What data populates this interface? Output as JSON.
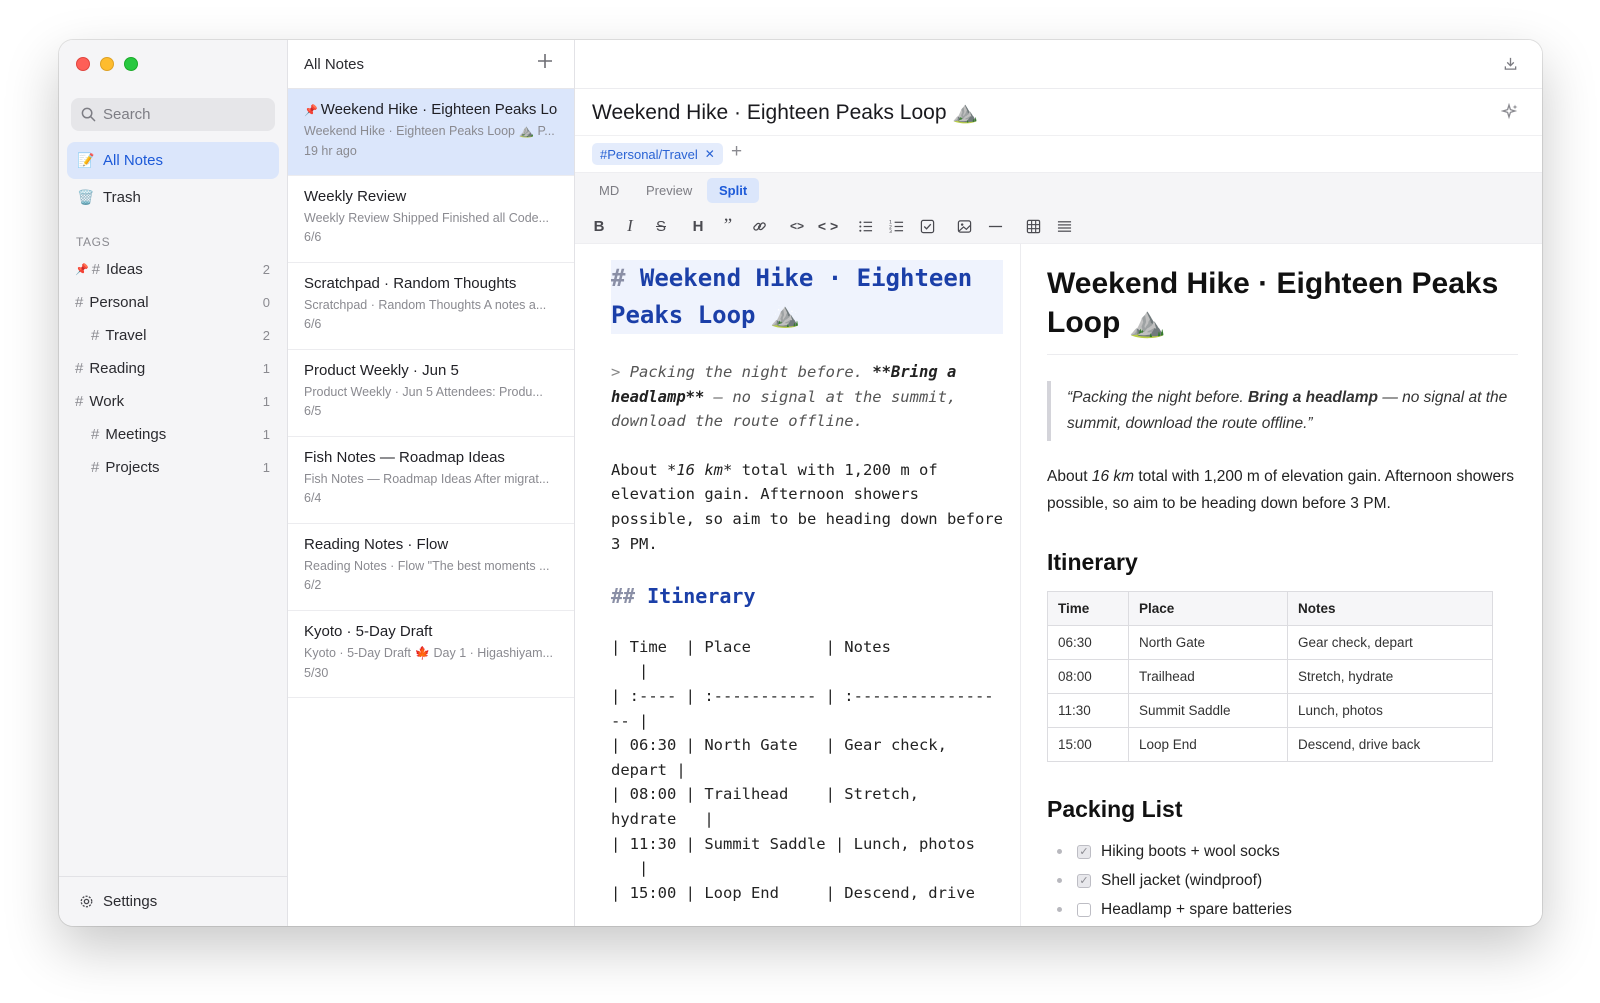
{
  "sidebar": {
    "search_placeholder": "Search",
    "nav": [
      {
        "label": "All Notes",
        "icon": "📝"
      },
      {
        "label": "Trash",
        "icon": "🗑️"
      }
    ],
    "tags_heading": "TAGS",
    "tags": [
      {
        "label": "Ideas",
        "count": "2",
        "pinned": true
      },
      {
        "label": "Personal",
        "count": "0"
      },
      {
        "label": "Travel",
        "count": "2"
      },
      {
        "label": "Reading",
        "count": "1"
      },
      {
        "label": "Work",
        "count": "1"
      },
      {
        "label": "Meetings",
        "count": "1"
      },
      {
        "label": "Projects",
        "count": "1"
      }
    ],
    "settings_label": "Settings"
  },
  "notes_list": {
    "title": "All Notes",
    "notes": [
      {
        "title": "Weekend Hike · Eighteen Peaks Loop",
        "snippet": "Weekend Hike · Eighteen Peaks Loop ⛰️ P...",
        "date": "19 hr ago"
      },
      {
        "title": "Weekly Review",
        "snippet": "Weekly Review Shipped Finished all Code...",
        "date": "6/6"
      },
      {
        "title": "Scratchpad · Random Thoughts",
        "snippet": "Scratchpad · Random Thoughts A notes a...",
        "date": "6/6"
      },
      {
        "title": "Product Weekly · Jun 5",
        "snippet": "Product Weekly · Jun 5 Attendees: Produ...",
        "date": "6/5"
      },
      {
        "title": "Fish Notes — Roadmap Ideas",
        "snippet": "Fish Notes — Roadmap Ideas After migrat...",
        "date": "6/4"
      },
      {
        "title": "Reading Notes · Flow",
        "snippet": "Reading Notes · Flow \"The best moments ...",
        "date": "6/2"
      },
      {
        "title": "Kyoto · 5-Day Draft",
        "snippet": "Kyoto · 5-Day Draft 🍁 Day 1 · Higashiyam...",
        "date": "5/30"
      }
    ]
  },
  "editor": {
    "doc_title": "Weekend Hike · Eighteen Peaks Loop ⛰️",
    "tag_chip": "#Personal/Travel",
    "modes": [
      "MD",
      "Preview",
      "Split"
    ],
    "active_mode": "Split",
    "markdown": {
      "h1_mark": "#",
      "h1_text": "Weekend Hike · Eighteen Peaks Loop ⛰️",
      "quote_prefix": ">",
      "quote_a": "Packing the night before.",
      "quote_bold": "**Bring a headlamp**",
      "quote_b": "— no signal at the summit, download the route offline.",
      "para_a": "About",
      "para_em": "*16 km*",
      "para_b": "total with 1,200 m of elevation gain. Afternoon showers possible, so aim to be heading down before 3 PM.",
      "h2_mark": "##",
      "h2_text": "Itinerary",
      "table_text": "| Time  | Place        | Notes\n   |\n| :---- | :----------- | :---------------\n-- |\n| 06:30 | North Gate   | Gear check,\ndepart |\n| 08:00 | Trailhead    | Stretch,\nhydrate   |\n| 11:30 | Summit Saddle | Lunch, photos\n   |\n| 15:00 | Loop End     | Descend, drive"
    },
    "preview": {
      "h1": "Weekend Hike · Eighteen Peaks Loop ⛰️",
      "quote_a": "“Packing the night before.",
      "quote_bold": "Bring a headlamp",
      "quote_b": "— no signal at the summit, download the route offline.”",
      "para_a": "About",
      "para_em": "16 km",
      "para_b": "total with 1,200 m of elevation gain. Afternoon showers possible, so aim to be heading down before 3 PM.",
      "h2_itinerary": "Itinerary",
      "table_headers": [
        "Time",
        "Place",
        "Notes"
      ],
      "table_rows": [
        [
          "06:30",
          "North Gate",
          "Gear check, depart"
        ],
        [
          "08:00",
          "Trailhead",
          "Stretch, hydrate"
        ],
        [
          "11:30",
          "Summit Saddle",
          "Lunch, photos"
        ],
        [
          "15:00",
          "Loop End",
          "Descend, drive back"
        ]
      ],
      "h2_packing": "Packing List",
      "packing": [
        {
          "label": "Hiking boots + wool socks",
          "checked": true
        },
        {
          "label": "Shell jacket (windproof)",
          "checked": true
        },
        {
          "label": "Headlamp + spare batteries",
          "checked": false
        }
      ]
    }
  },
  "colors": {
    "accent": "#1d5ad8",
    "selection": "#dbe6fb",
    "md_heading": "#1b3fa8"
  }
}
